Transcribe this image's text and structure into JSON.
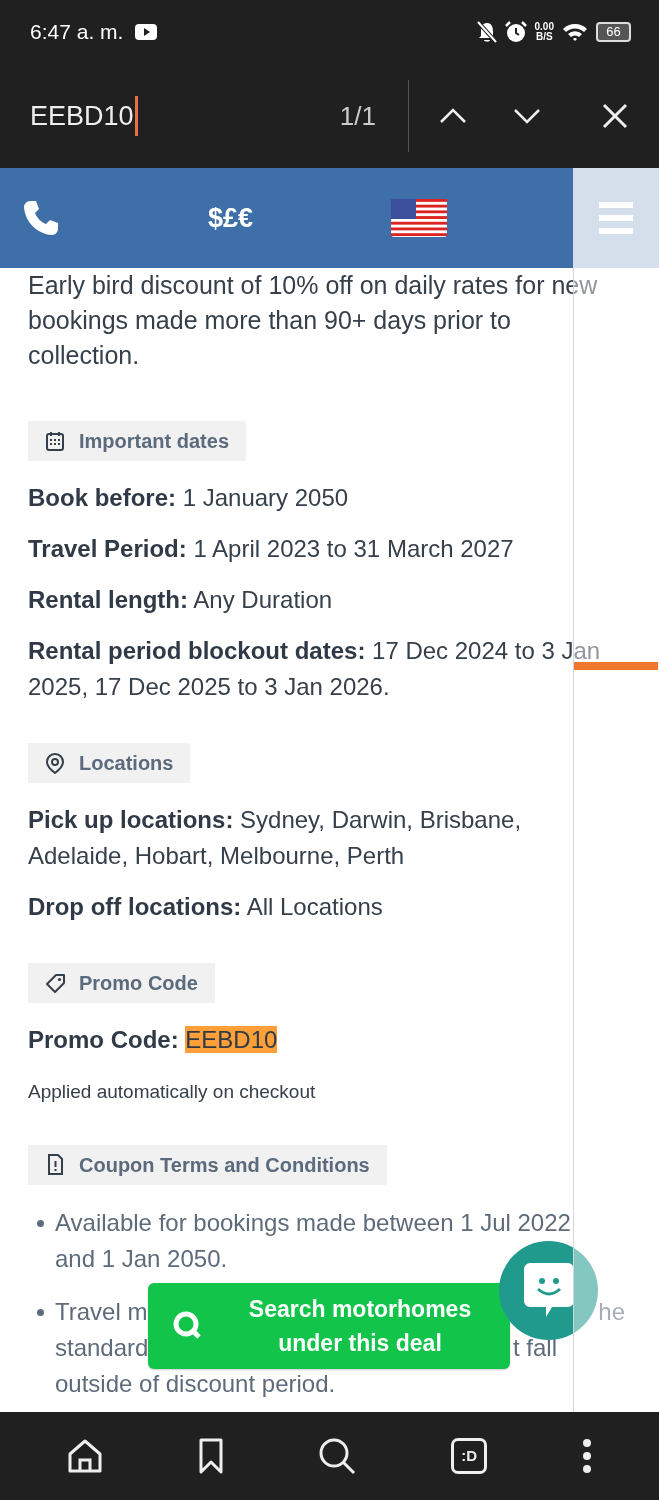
{
  "status_bar": {
    "time": "6:47 a. m.",
    "net_speed": "0.00",
    "net_unit": "B/S",
    "battery": "66"
  },
  "find_bar": {
    "query": "EEBD10",
    "count": "1/1"
  },
  "site_nav": {
    "currency": "$£€"
  },
  "intro": "Early bird discount of 10% off on daily rates for new bookings made more than 90+ days prior to collection.",
  "sections": [
    {
      "kind": "dates",
      "heading": "Important dates",
      "items": [
        {
          "label": "Book before:",
          "value": "1 January 2050"
        },
        {
          "label": "Travel Period:",
          "value": "1 April 2023 to 31 March 2027"
        },
        {
          "label": "Rental length:",
          "value": "Any Duration"
        },
        {
          "label": "Rental period blockout dates:",
          "value": "17 Dec 2024 to 3 Jan 2025, 17 Dec 2025 to 3 Jan 2026."
        }
      ]
    },
    {
      "kind": "locations",
      "heading": "Locations",
      "items": [
        {
          "label": "Pick up locations:",
          "value": "Sydney, Darwin, Brisbane, Adelaide, Hobart, Melbourne, Perth"
        },
        {
          "label": "Drop off locations:",
          "value": "All Locations"
        }
      ]
    },
    {
      "kind": "promo",
      "heading": "Promo Code",
      "items": [
        {
          "label": "Promo Code:",
          "value": "EEBD10",
          "highlighted": true
        }
      ],
      "note": "Applied automatically on checkout"
    },
    {
      "kind": "terms",
      "heading": "Coupon Terms and Conditions",
      "bullets": [
        {
          "lines": [
            [
              "Available for bookings made between 1 Jul 2022"
            ],
            [
              "and 1 Jan 2050."
            ]
          ]
        },
        {
          "lines": [
            [
              "Travel m",
              "he"
            ],
            [
              "standard",
              "t fall"
            ],
            [
              "outside of discount period."
            ]
          ]
        }
      ]
    }
  ],
  "cta": {
    "label": "Search motorhomes under this deal"
  },
  "bottom_nav": {
    "tabs_label": ":D"
  }
}
